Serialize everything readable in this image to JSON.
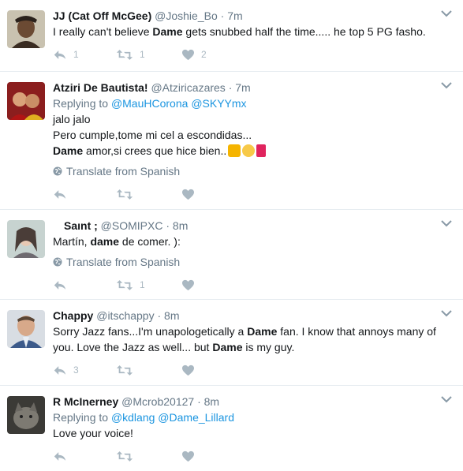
{
  "tweets": [
    {
      "name": "JJ (Cat Off McGee)",
      "handle": "@Joshie_Bo",
      "time": "7m",
      "text_parts": [
        "I really can't believe ",
        "Dame",
        " gets snubbed half the time..... he top 5 PG fasho."
      ],
      "reply_count": "1",
      "retweet_count": "1",
      "like_count": "2"
    },
    {
      "name": "Atziri De Bautista!",
      "handle": "@Atziricazares",
      "time": "7m",
      "replying_label": "Replying to",
      "replying_to": [
        "@MauHCorona",
        "@SKYYmx"
      ],
      "line1": "jalo jalo",
      "line2": "Pero cumple,tome mi cel a escondidas...",
      "line3_bold": "Dame",
      "line3_rest": " amor,si crees que hice bien..",
      "translate": "Translate from Spanish"
    },
    {
      "name": "Saınt ;",
      "handle": "@SOMIPXC",
      "time": "8m",
      "text_a": "Martín, ",
      "text_bold": "dame",
      "text_b": " de comer. ):",
      "translate": "Translate from Spanish",
      "retweet_count": "1"
    },
    {
      "name": "Chappy",
      "handle": "@itschappy",
      "time": "8m",
      "t1": "Sorry Jazz fans...I'm unapologetically a ",
      "t2": "Dame",
      "t3": " fan. I know that annoys many of you. Love the Jazz as well... but ",
      "t4": "Dame",
      "t5": " is my guy.",
      "reply_count": "3"
    },
    {
      "name": "R McInerney",
      "handle": "@Mcrob20127",
      "time": "8m",
      "replying_label": "Replying to",
      "replying_to": [
        "@kdlang",
        "@Dame_Lillard"
      ],
      "text": "Love your voice!"
    }
  ],
  "separator": "·",
  "colors": {
    "link": "#1b95e0",
    "muted": "#657786",
    "icon": "#aab8c2"
  },
  "icons": [
    "reply-icon",
    "retweet-icon",
    "like-icon",
    "globe-icon",
    "chevron-down-icon"
  ]
}
